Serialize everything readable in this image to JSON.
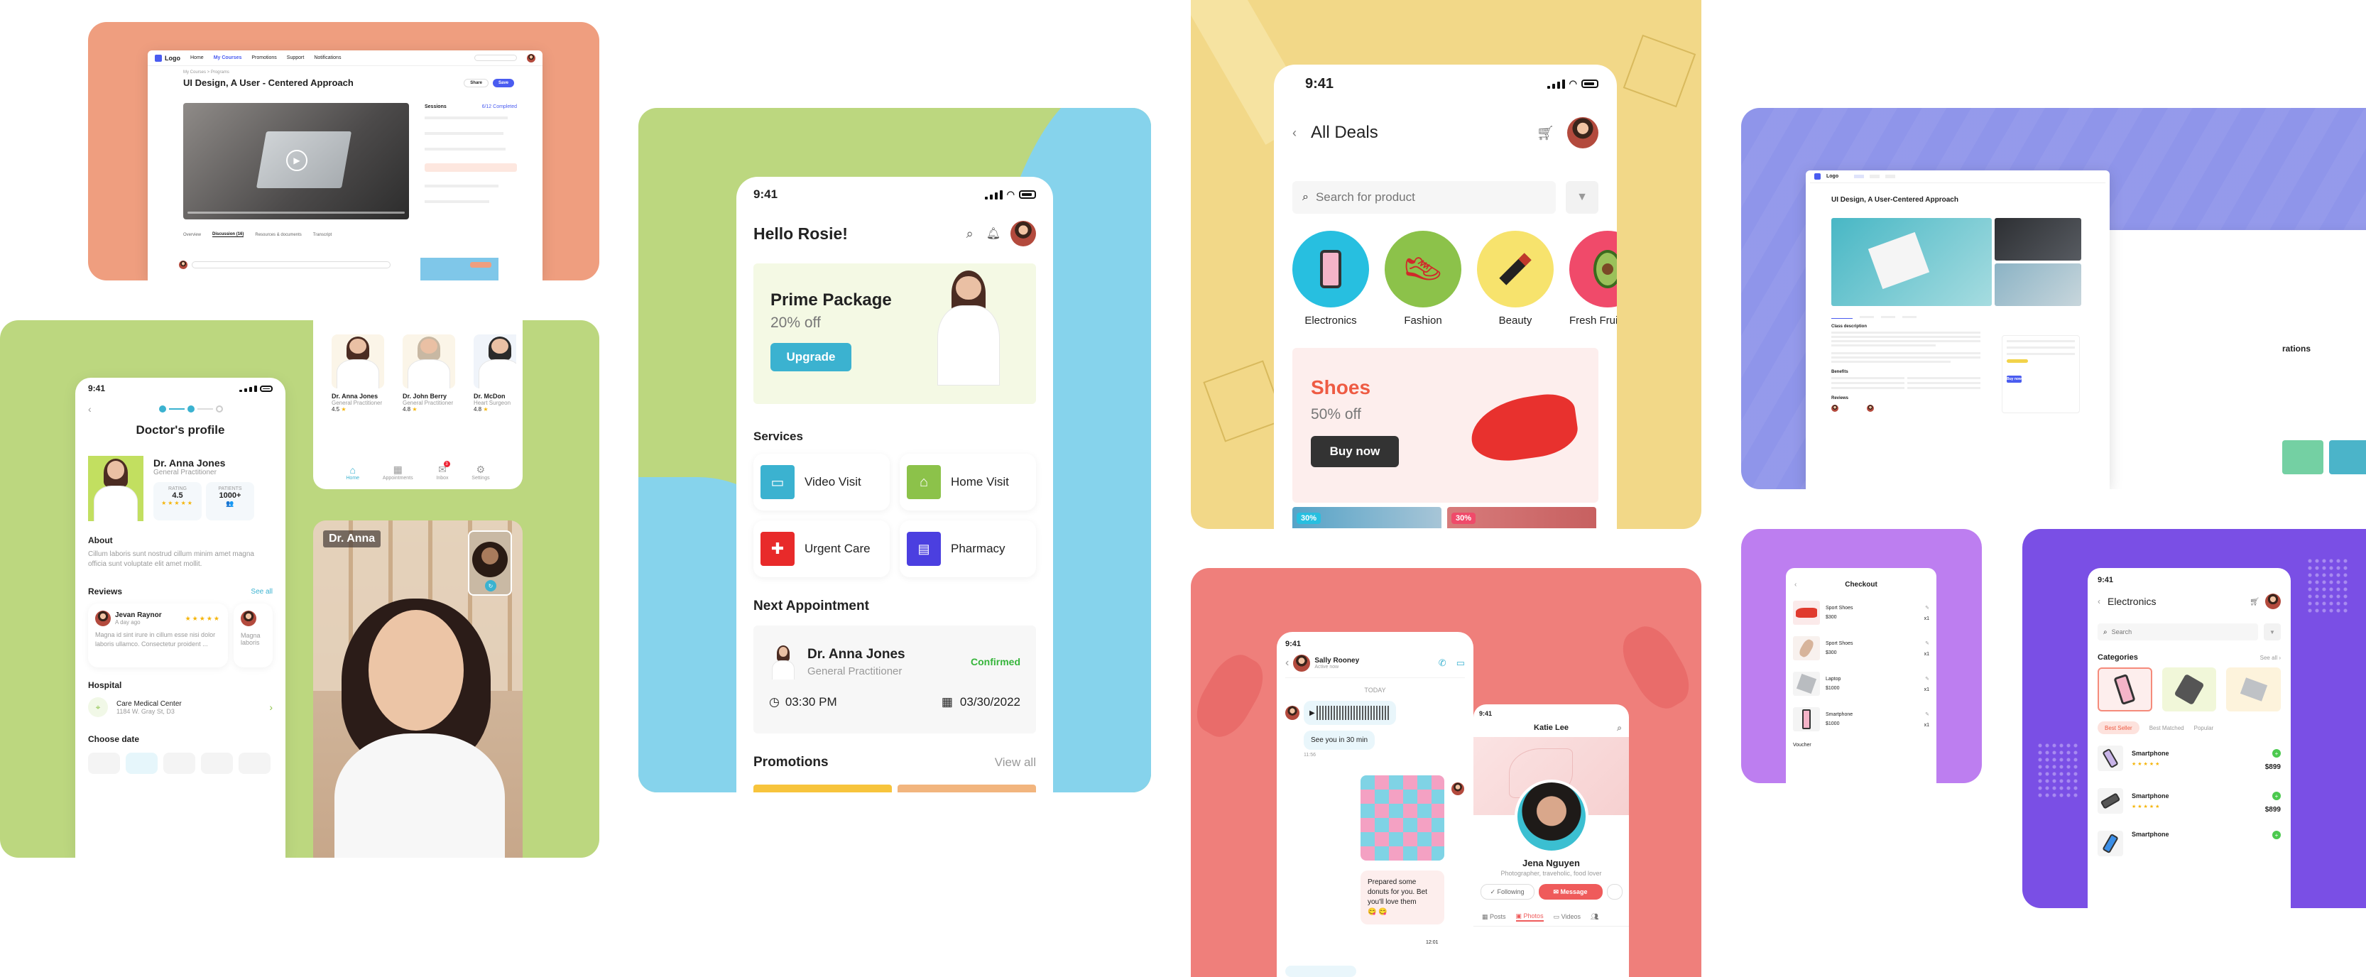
{
  "elearn": {
    "logo": "Logo",
    "nav": [
      "Home",
      "My Courses",
      "Promotions",
      "Support",
      "Notifications"
    ],
    "breadcrumb": "My Courses > Programs",
    "title": "UI Design, A User - Centered Approach",
    "sessions_label": "Sessions",
    "sessions_count": "6/12 Completed",
    "tabs": [
      "Overview",
      "Discussion (16)",
      "Resources & documents",
      "Transcript"
    ],
    "share": "Share",
    "save": "Save"
  },
  "doctor_profile": {
    "time": "9:41",
    "title": "Doctor's profile",
    "name": "Dr. Anna Jones",
    "role": "General Practitioner",
    "rating_label": "RATING",
    "rating_value": "4.5",
    "patients_label": "PATIENTS",
    "patients_value": "1000+",
    "about_label": "About",
    "about_text": "Cillum laboris sunt nostrud cillum minim amet magna officia sunt voluptate elit amet mollit.",
    "reviews_label": "Reviews",
    "see_all": "See all",
    "reviewer": "Jevan Raynor",
    "review_time": "A day ago",
    "review_text": "Magna id sint irure in cillum esse nisi dolor laboris ullamco. Consectetur proident ...",
    "review_text2": "Magna laboris",
    "hospital_label": "Hospital",
    "hospital_name": "Care Medical Center",
    "hospital_addr": "1184 W. Gray St, D3",
    "choose_date": "Choose date"
  },
  "doctor_list": {
    "doctors": [
      {
        "name": "Dr. Anna Jones",
        "role": "General Practitioner",
        "rating": "4.5"
      },
      {
        "name": "Dr. John Berry",
        "role": "General Practitioner",
        "rating": "4.8"
      },
      {
        "name": "Dr. McDon",
        "role": "Heart Surgeon",
        "rating": "4.8"
      }
    ],
    "nav": [
      "Home",
      "Appointments",
      "Inbox",
      "Settings"
    ],
    "badge": "3"
  },
  "video_call": {
    "name": "Dr. Anna"
  },
  "health_home": {
    "time": "9:41",
    "greeting": "Hello Rosie!",
    "promo_title": "Prime Package",
    "promo_off": "20% off",
    "upgrade": "Upgrade",
    "services_label": "Services",
    "services": [
      "Video Visit",
      "Home Visit",
      "Urgent Care",
      "Pharmacy"
    ],
    "next_label": "Next Appointment",
    "appt_name": "Dr. Anna Jones",
    "appt_role": "General Practitioner",
    "appt_status": "Confirmed",
    "appt_time": "03:30 PM",
    "appt_date": "03/30/2022",
    "promotions_label": "Promotions",
    "view_all": "View all"
  },
  "deals": {
    "time": "9:41",
    "title": "All Deals",
    "search_placeholder": "Search for product",
    "categories": [
      "Electronics",
      "Fashion",
      "Beauty",
      "Fresh Fruit"
    ],
    "promo_title": "Shoes",
    "promo_off": "50% off",
    "buy_now": "Buy now",
    "badge1": "30%",
    "badge2": "30%"
  },
  "chat": {
    "time": "9:41",
    "contact": "Sally Rooney",
    "status": "Active now",
    "today": "TODAY",
    "msg1": "See you in 30 min",
    "msg1_time": "11:56",
    "msg2": "Prepared some donuts for you. Bet you'll love them",
    "msg2_emoji": "😋 😋",
    "msg2_time": "12:01"
  },
  "social_profile": {
    "time": "9:41",
    "header": "Katie Lee",
    "name": "Jena Nguyen",
    "bio": "Photographer, traveholic, food lover",
    "following": "Following",
    "message": "Message",
    "tabs": [
      "Posts",
      "Photos",
      "Videos"
    ]
  },
  "ecom_desktop": {
    "logo": "Logo",
    "title": "UI Design, A User-Centered Approach",
    "section1": "Class description",
    "section2": "Benefits",
    "section3": "Reviews",
    "side_text": "rations",
    "buy": "Buy now"
  },
  "checkout": {
    "title": "Checkout",
    "items": [
      {
        "name": "Sport Shoes",
        "price": "$300",
        "qty": "x1"
      },
      {
        "name": "Sport Shoes",
        "price": "$300",
        "qty": "x1"
      },
      {
        "name": "Laptop",
        "price": "$1000",
        "qty": "x1"
      },
      {
        "name": "Smartphone",
        "price": "$1000",
        "qty": "x1"
      }
    ],
    "voucher": "Voucher"
  },
  "electronics": {
    "time": "9:41",
    "title": "Electronics",
    "search_placeholder": "Search",
    "categories_label": "Categories",
    "see_all": "See all",
    "filters": [
      "Best Seller",
      "Best Matched",
      "Popular"
    ],
    "products": [
      {
        "name": "Smartphone",
        "price": "$899"
      },
      {
        "name": "Smartphone",
        "price": "$899"
      },
      {
        "name": "Smartphone",
        "price": ""
      }
    ]
  },
  "colors": {
    "salmon": "#ef9e7f",
    "green": "#bcd77f",
    "teal": "#2aa8c9",
    "yellow": "#f2d888",
    "coral": "#ef7f7b",
    "periwinkle": "#8f95ea",
    "violet": "#bd7ef0",
    "purple": "#7a4fe5",
    "shoes_red": "#ee5b43"
  }
}
